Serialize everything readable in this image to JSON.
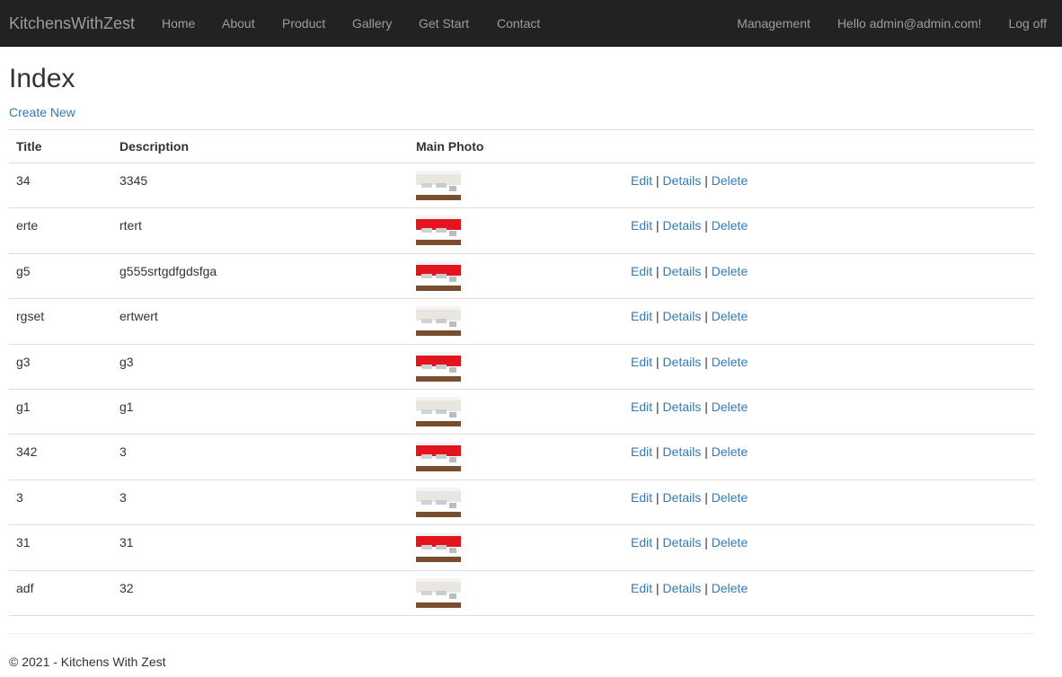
{
  "nav": {
    "brand": "KitchensWithZest",
    "links": [
      "Home",
      "About",
      "Product",
      "Gallery",
      "Get Start",
      "Contact"
    ],
    "management": "Management",
    "greeting": "Hello admin@admin.com!",
    "logoff": "Log off"
  },
  "page": {
    "title": "Index",
    "create_new": "Create New"
  },
  "table": {
    "headers": [
      "Title",
      "Description",
      "Main Photo"
    ],
    "rows": [
      {
        "title": "34",
        "description": "3345",
        "photo": "kitchen-white"
      },
      {
        "title": "erte",
        "description": "rtert",
        "photo": "kitchen-red"
      },
      {
        "title": "g5",
        "description": "g555srtgdfgdsfga",
        "photo": "kitchen-red"
      },
      {
        "title": "rgset",
        "description": "ertwert",
        "photo": "kitchen-white"
      },
      {
        "title": "g3",
        "description": "g3",
        "photo": "kitchen-red"
      },
      {
        "title": "g1",
        "description": "g1",
        "photo": "kitchen-white"
      },
      {
        "title": "342",
        "description": "3",
        "photo": "kitchen-red"
      },
      {
        "title": "3",
        "description": "3",
        "photo": "kitchen-white"
      },
      {
        "title": "31",
        "description": "31",
        "photo": "kitchen-red"
      },
      {
        "title": "adf",
        "description": "32",
        "photo": "kitchen-white"
      }
    ],
    "actions": {
      "edit": "Edit",
      "details": "Details",
      "delete": "Delete",
      "sep": "|"
    }
  },
  "footer": {
    "text": "© 2021 - Kitchens With Zest"
  },
  "colors": {
    "navbar": "#222222",
    "nav_text": "#9d9d9d",
    "link": "#337ab7",
    "accent_red": "#e3141e"
  }
}
